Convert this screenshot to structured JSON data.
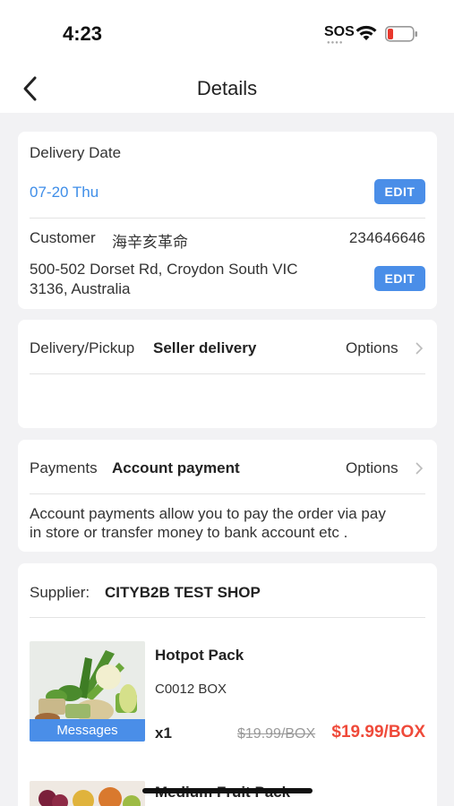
{
  "status_bar": {
    "time": "4:23",
    "sos": "SOS"
  },
  "nav": {
    "title": "Details"
  },
  "delivery_card": {
    "date_label": "Delivery Date",
    "date_value": "07-20 Thu",
    "edit_label": "EDIT",
    "customer_label": "Customer",
    "customer_name": "海辛亥革命",
    "customer_phone": "234646646",
    "address_line1": "500-502 Dorset Rd, Croydon South VIC",
    "address_line2": "3136, Australia",
    "address_edit_label": "EDIT"
  },
  "delivery_method": {
    "label": "Delivery/Pickup",
    "value": "Seller delivery",
    "options_label": "Options"
  },
  "payment": {
    "label": "Payments",
    "value": "Account payment",
    "options_label": "Options",
    "description_line1": "Account payments allow you to pay the order via pay",
    "description_line2": "in store or transfer money to bank account etc ."
  },
  "supplier": {
    "label": "Supplier:",
    "name": "CITYB2B TEST SHOP"
  },
  "products": [
    {
      "name": "Hotpot Pack",
      "code": "C0012 BOX",
      "quantity": "x1",
      "original_price": "$19.99/BOX",
      "price": "$19.99/BOX",
      "messages_label": "Messages"
    },
    {
      "name": "Medium Fruit Pack"
    }
  ],
  "colors": {
    "accent": "#4a8ee8",
    "price_red": "#ef4a3a",
    "date_blue": "#3f8ee8"
  }
}
